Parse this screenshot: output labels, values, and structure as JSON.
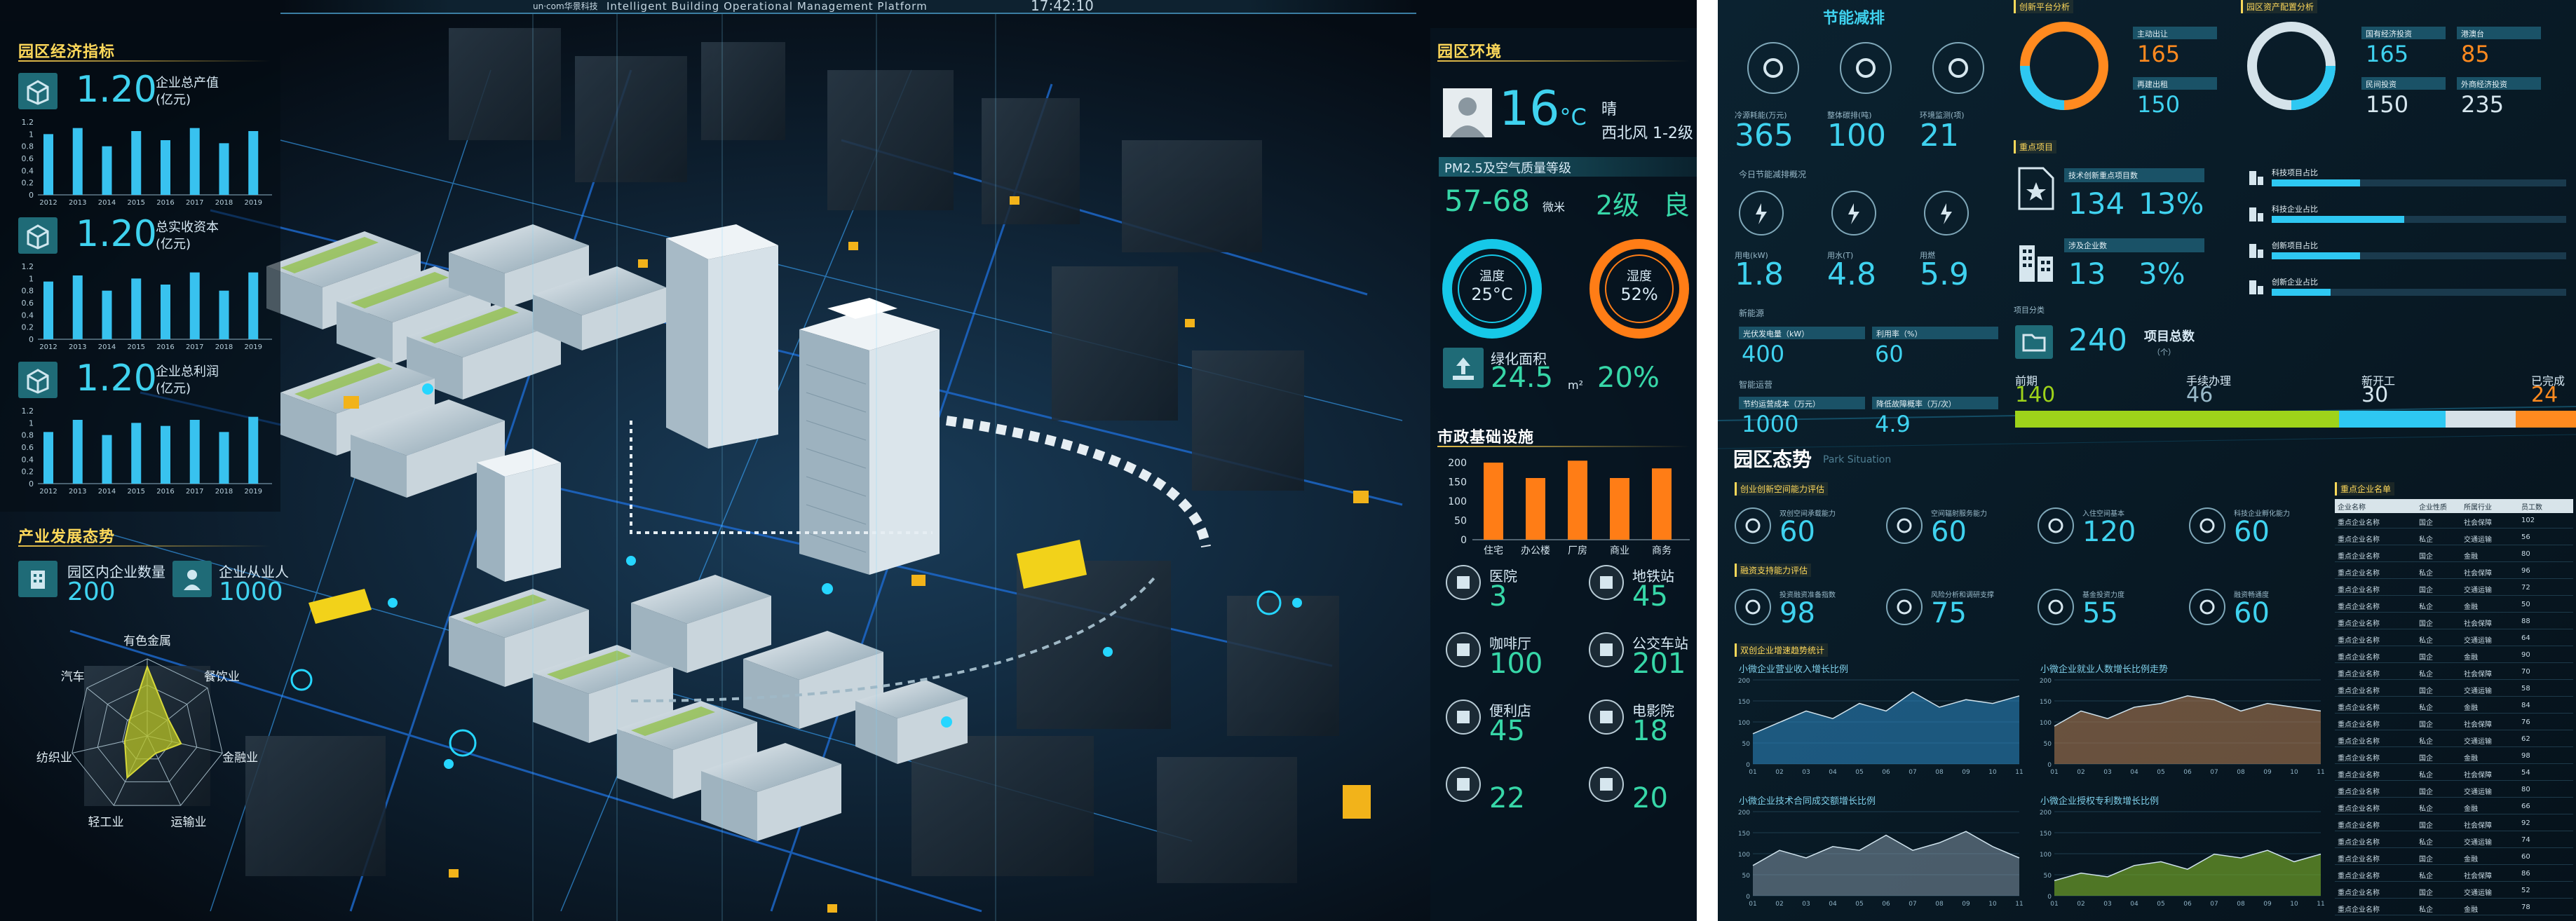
{
  "header": {
    "subtitle": "Intelligent Building Operational Management Platform",
    "clock": "17:42:10",
    "brand": "un·com华景科技"
  },
  "left": {
    "economy": {
      "title": "园区经济指标",
      "metrics": [
        {
          "value": "1.20",
          "label": "企业总产值",
          "unit": "(亿元)"
        },
        {
          "value": "1.20",
          "label": "总实收资本",
          "unit": "(亿元)"
        },
        {
          "value": "1.20",
          "label": "企业总利润",
          "unit": "(亿元)"
        }
      ],
      "years": [
        "2012",
        "2013",
        "2014",
        "2015",
        "2016",
        "2017",
        "2018",
        "2019"
      ],
      "yticks": [
        "1.2",
        "1",
        "0.8",
        "0.6",
        "0.4",
        "0.2",
        "0"
      ],
      "bars": [
        [
          1.0,
          1.1,
          0.8,
          1.05,
          0.9,
          1.1,
          0.85,
          1.05
        ],
        [
          0.95,
          1.05,
          0.8,
          1.0,
          0.9,
          1.1,
          0.8,
          1.1
        ],
        [
          0.85,
          1.05,
          0.8,
          1.0,
          0.95,
          1.05,
          0.85,
          1.1
        ]
      ]
    },
    "industry": {
      "title": "产业发展态势",
      "enterprise_count_label": "园区内企业数量",
      "enterprise_count": "200",
      "employee_label": "企业从业人",
      "employee_count": "1000",
      "radar_labels": [
        "有色金属",
        "餐饮业",
        "金融业",
        "运输业",
        "轻工业",
        "纺织业",
        "汽车"
      ]
    },
    "environment": {
      "title": "园区环境",
      "temp": "16",
      "temp_unit": "°C",
      "weather": "晴",
      "wind": "西北风 1-2级",
      "aqi_label": "PM2.5及空气质量等级",
      "pm_range": "57-68",
      "pm_unit": "微米",
      "aqi_level": "2级",
      "aqi_text": "良",
      "temp_ring_label": "温度",
      "temp_ring_value": "25°C",
      "humidity_label": "湿度",
      "humidity_value": "52%",
      "green_label": "绿化面积",
      "green_value": "24.5",
      "green_unit": "m²",
      "green_pct": "20%"
    },
    "municipal": {
      "title": "市政基础设施",
      "chart": {
        "type": "bar",
        "categories": [
          "住宅",
          "办公楼",
          "厂房",
          "商业",
          "商务"
        ],
        "values": [
          200,
          160,
          205,
          160,
          185
        ],
        "yticks": [
          "200",
          "150",
          "100",
          "50",
          "0"
        ]
      },
      "items": [
        {
          "label": "医院",
          "value": "3"
        },
        {
          "label": "地铁站",
          "value": "45"
        },
        {
          "label": "咖啡厅",
          "value": "100"
        },
        {
          "label": "公交车站",
          "value": "201"
        },
        {
          "label": "便利店",
          "value": "45"
        },
        {
          "label": "电影院",
          "value": "18"
        },
        {
          "label": "",
          "value": "22"
        },
        {
          "label": "",
          "value": "20"
        }
      ]
    }
  },
  "right": {
    "energy": {
      "title": "节能减排",
      "top": [
        {
          "label": "冷源耗能(万元)",
          "value": "365"
        },
        {
          "label": "整体碳排(吨)",
          "value": "100"
        },
        {
          "label": "环境监测(项)",
          "value": "21"
        }
      ],
      "today_label": "今日节能减排概况",
      "mid": [
        {
          "label": "用电(kW)",
          "value": "1.8"
        },
        {
          "label": "用水(T)",
          "value": "4.8"
        },
        {
          "label": "用燃",
          "value": "5.9"
        }
      ],
      "newenergy_label": "新能源",
      "ne": [
        {
          "label": "光伏发电量（kW）",
          "value": "400"
        },
        {
          "label": "利用率（%）",
          "value": "60"
        }
      ],
      "smart_label": "智能运营",
      "sm": [
        {
          "label": "节约运营成本（万元）",
          "value": "1000"
        },
        {
          "label": "降低故障概率（万/次）",
          "value": "4.9"
        }
      ]
    },
    "innovation": {
      "tag": "创新平台分析",
      "items": [
        {
          "label": "主动出让",
          "value": "165"
        },
        {
          "label": "再建出租",
          "value": "150"
        }
      ]
    },
    "industry_analysis": {
      "tag": "园区资产配置分析",
      "items": [
        {
          "label": "国有经济投资",
          "value": "165"
        },
        {
          "label": "港澳台",
          "value": "85"
        },
        {
          "label": "民间投资",
          "value": "150"
        },
        {
          "label": "外商经济投资",
          "value": "235"
        }
      ]
    },
    "key_projects": {
      "tag": "重点项目",
      "a_label": "技术创新重点项目数",
      "a_value": "134",
      "a_pct": "13%",
      "b_label": "涉及企业数",
      "b_value": "13",
      "b_pct": "3%",
      "bars": [
        {
          "label": "科技项目占比"
        },
        {
          "label": "科技企业占比"
        },
        {
          "label": "创新项目占比"
        },
        {
          "label": "创新企业占比"
        }
      ]
    },
    "project_class": {
      "label": "项目分类",
      "total": "240",
      "total_label": "项目总数",
      "total_unit": "（个）",
      "stages": [
        {
          "label": "前期",
          "value": "140"
        },
        {
          "label": "手续办理",
          "value": "46"
        },
        {
          "label": "新开工",
          "value": "30"
        },
        {
          "label": "已完成",
          "value": "24"
        }
      ]
    },
    "situation": {
      "title": "园区态势",
      "subtitle": "Park Situation",
      "g1_tag": "创业创新空间能力评估",
      "g1": [
        {
          "label": "双创空间承载能力",
          "value": "60"
        },
        {
          "label": "空间辐射服务能力",
          "value": "60"
        },
        {
          "label": "入住空间基本",
          "value": "120"
        },
        {
          "label": "科技企业孵化能力",
          "value": "60"
        }
      ],
      "g2_tag": "融资支持能力评估",
      "g2": [
        {
          "label": "投资融资准备指数",
          "value": "98"
        },
        {
          "label": "风险分析和调研支撑",
          "value": "75"
        },
        {
          "label": "基金投资力度",
          "value": "55"
        },
        {
          "label": "融资畅通度",
          "value": "60"
        }
      ],
      "g3_tag": "双创企业增速趋势统计",
      "charts": [
        {
          "title": "小微企业营业收入增长比例"
        },
        {
          "title": "小微企业就业人数增长比例走势"
        },
        {
          "title": "小微企业技术合同成交额增长比例"
        },
        {
          "title": "小微企业授权专利数增长比例"
        }
      ]
    },
    "table": {
      "tag": "重点企业名单",
      "headers": [
        "企业名称",
        "企业性质",
        "所属行业",
        "员工数"
      ],
      "rows": [
        [
          "重点企业名称",
          "国企",
          "社会保障",
          "102"
        ],
        [
          "重点企业名称",
          "私企",
          "交通运输",
          "56"
        ],
        [
          "重点企业名称",
          "国企",
          "金融",
          "80"
        ],
        [
          "重点企业名称",
          "私企",
          "社会保障",
          "96"
        ],
        [
          "重点企业名称",
          "国企",
          "交通运输",
          "72"
        ],
        [
          "重点企业名称",
          "私企",
          "金融",
          "50"
        ],
        [
          "重点企业名称",
          "国企",
          "社会保障",
          "88"
        ],
        [
          "重点企业名称",
          "私企",
          "交通运输",
          "64"
        ],
        [
          "重点企业名称",
          "国企",
          "金融",
          "90"
        ],
        [
          "重点企业名称",
          "私企",
          "社会保障",
          "70"
        ],
        [
          "重点企业名称",
          "国企",
          "交通运输",
          "58"
        ],
        [
          "重点企业名称",
          "私企",
          "金融",
          "84"
        ],
        [
          "重点企业名称",
          "国企",
          "社会保障",
          "76"
        ],
        [
          "重点企业名称",
          "私企",
          "交通运输",
          "62"
        ],
        [
          "重点企业名称",
          "国企",
          "金融",
          "98"
        ],
        [
          "重点企业名称",
          "私企",
          "社会保障",
          "54"
        ],
        [
          "重点企业名称",
          "国企",
          "交通运输",
          "80"
        ],
        [
          "重点企业名称",
          "私企",
          "金融",
          "66"
        ],
        [
          "重点企业名称",
          "国企",
          "社会保障",
          "92"
        ],
        [
          "重点企业名称",
          "私企",
          "交通运输",
          "74"
        ],
        [
          "重点企业名称",
          "国企",
          "金融",
          "60"
        ],
        [
          "重点企业名称",
          "私企",
          "社会保障",
          "86"
        ],
        [
          "重点企业名称",
          "国企",
          "交通运输",
          "52"
        ],
        [
          "重点企业名称",
          "私企",
          "金融",
          "78"
        ]
      ]
    }
  }
}
